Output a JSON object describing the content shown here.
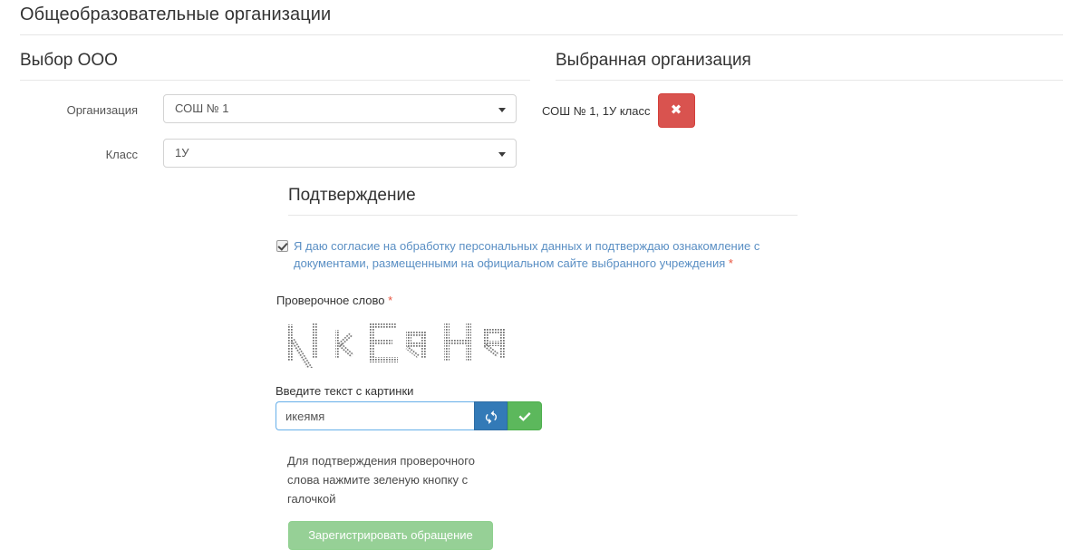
{
  "page": {
    "title": "Общеобразовательные организации"
  },
  "left_section": {
    "heading": "Выбор ООО",
    "fields": [
      {
        "label": "Организация",
        "value": "СОШ № 1"
      },
      {
        "label": "Класс",
        "value": "1У"
      }
    ]
  },
  "right_section": {
    "heading": "Выбранная организация",
    "chosen": "СОШ № 1, 1У класс",
    "remove_label": "✖"
  },
  "confirmation": {
    "heading": "Подтверждение",
    "consent_text": "Я даю согласие на обработку персональных данных и подтверждаю ознакомление с документами, размещенными на официальном сайте выбранного учреждения",
    "required_mark": "*",
    "consent_checked": "true",
    "captcha_label": "Проверочное слово",
    "captcha_word": "ИкЕяНя",
    "entry_label": "Введите текст с картинки",
    "entry_value": "икеямя",
    "entry_placeholder": "",
    "refresh_title": "refresh-icon",
    "verify_title": "check-icon",
    "hint": "Для подтверждения проверочного слова нажмите зеленую кнопку с галочкой",
    "submit_label": "Зарегистрировать обращение"
  },
  "colors": {
    "danger": "#d9534f",
    "primary": "#337ab7",
    "success": "#5cb85c",
    "success_muted": "#96d096",
    "link": "#5a8fc4",
    "required": "#e8543f",
    "rule": "#e5e5e5"
  }
}
